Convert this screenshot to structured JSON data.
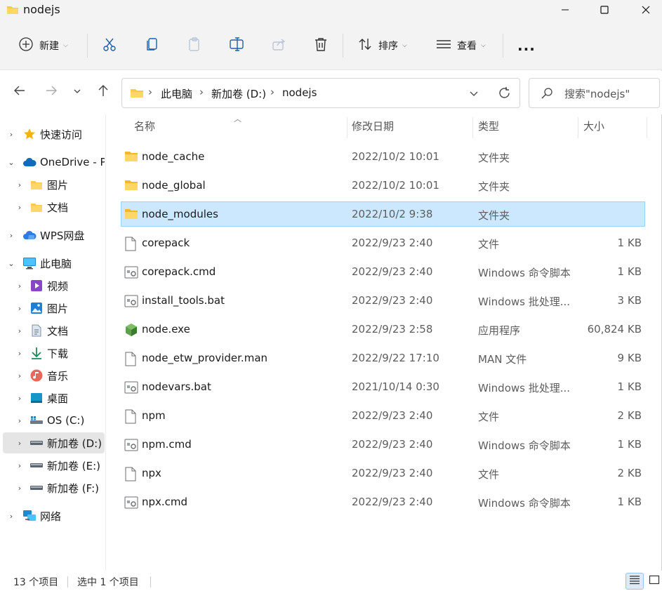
{
  "window": {
    "title": "nodejs"
  },
  "toolbar": {
    "new_label": "新建",
    "sort_label": "排序",
    "view_label": "查看",
    "more_label": "..."
  },
  "address": {
    "crumbs": [
      "此电脑",
      "新加卷 (D:)",
      "nodejs"
    ],
    "search_placeholder": "搜索\"nodejs\""
  },
  "sidebar": {
    "items": [
      {
        "label": "快速访问"
      },
      {
        "label": "OneDrive - P"
      },
      {
        "label": "图片"
      },
      {
        "label": "文档"
      },
      {
        "label": "WPS网盘"
      },
      {
        "label": "此电脑"
      },
      {
        "label": "视频"
      },
      {
        "label": "图片"
      },
      {
        "label": "文档"
      },
      {
        "label": "下载"
      },
      {
        "label": "音乐"
      },
      {
        "label": "桌面"
      },
      {
        "label": "OS (C:)"
      },
      {
        "label": "新加卷 (D:)"
      },
      {
        "label": "新加卷 (E:)"
      },
      {
        "label": "新加卷 (F:)"
      },
      {
        "label": "网络"
      }
    ]
  },
  "columns": {
    "name": "名称",
    "date": "修改日期",
    "type": "类型",
    "size": "大小"
  },
  "files": [
    {
      "name": "node_cache",
      "date": "2022/10/2 10:01",
      "type": "文件夹",
      "size": "",
      "icon": "folder"
    },
    {
      "name": "node_global",
      "date": "2022/10/2 10:01",
      "type": "文件夹",
      "size": "",
      "icon": "folder"
    },
    {
      "name": "node_modules",
      "date": "2022/10/2 9:38",
      "type": "文件夹",
      "size": "",
      "icon": "folder"
    },
    {
      "name": "corepack",
      "date": "2022/9/23 2:40",
      "type": "文件",
      "size": "1 KB",
      "icon": "file"
    },
    {
      "name": "corepack.cmd",
      "date": "2022/9/23 2:40",
      "type": "Windows 命令脚本",
      "size": "1 KB",
      "icon": "script"
    },
    {
      "name": "install_tools.bat",
      "date": "2022/9/23 2:40",
      "type": "Windows 批处理...",
      "size": "3 KB",
      "icon": "script"
    },
    {
      "name": "node.exe",
      "date": "2022/9/23 2:58",
      "type": "应用程序",
      "size": "60,824 KB",
      "icon": "node"
    },
    {
      "name": "node_etw_provider.man",
      "date": "2022/9/22 17:10",
      "type": "MAN 文件",
      "size": "9 KB",
      "icon": "file"
    },
    {
      "name": "nodevars.bat",
      "date": "2021/10/14 0:30",
      "type": "Windows 批处理...",
      "size": "1 KB",
      "icon": "script"
    },
    {
      "name": "npm",
      "date": "2022/9/23 2:40",
      "type": "文件",
      "size": "2 KB",
      "icon": "file"
    },
    {
      "name": "npm.cmd",
      "date": "2022/9/23 2:40",
      "type": "Windows 命令脚本",
      "size": "1 KB",
      "icon": "script"
    },
    {
      "name": "npx",
      "date": "2022/9/23 2:40",
      "type": "文件",
      "size": "2 KB",
      "icon": "file"
    },
    {
      "name": "npx.cmd",
      "date": "2022/9/23 2:40",
      "type": "Windows 命令脚本",
      "size": "1 KB",
      "icon": "script"
    }
  ],
  "status": {
    "count": "13 个项目",
    "selected": "选中 1 个项目"
  },
  "colors": {
    "folder": "#f8c94a",
    "selection": "#cce8ff",
    "selection_border": "#99d1ff",
    "accent": "#0067c0"
  }
}
